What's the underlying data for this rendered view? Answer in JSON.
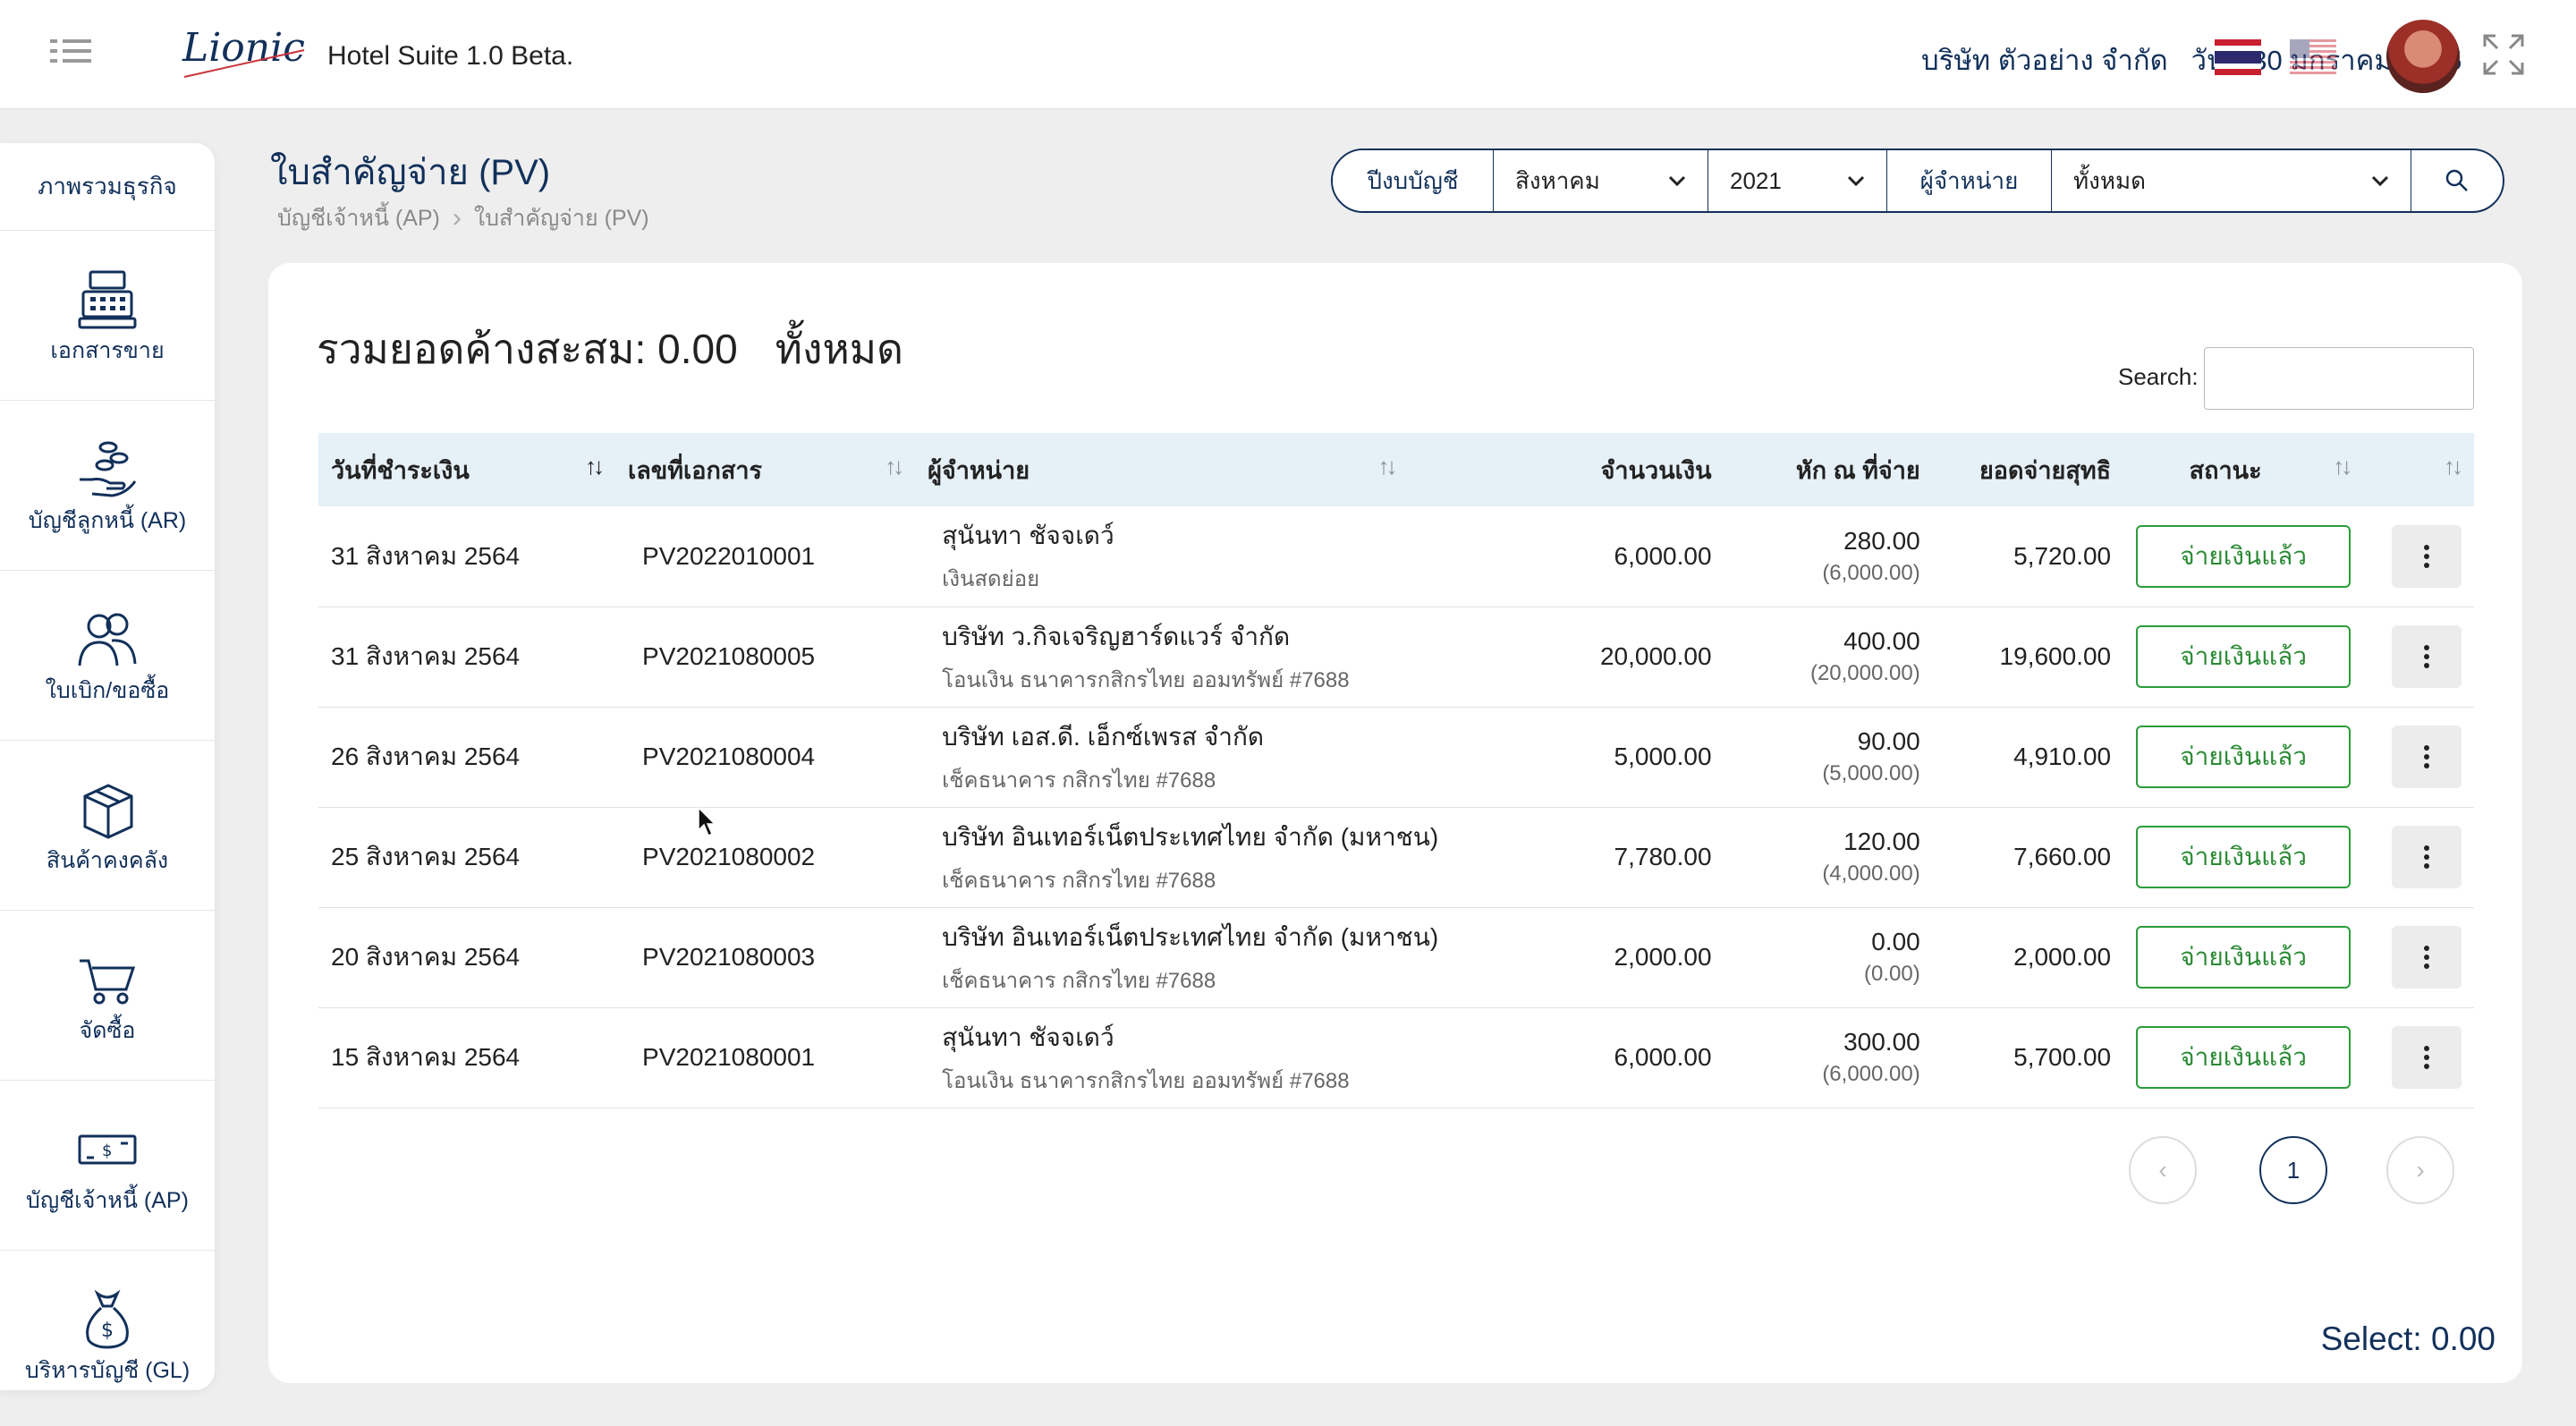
{
  "header": {
    "app_title": "Hotel Suite 1.0 Beta.",
    "logo_text": "Lionic",
    "company": "บริษัท ตัวอย่าง จำกัด",
    "date": "วันที่ 30 มกราคม 2565",
    "icons": [
      "menu-icon",
      "flag-th-icon",
      "flag-us-icon",
      "avatar",
      "expand-icon"
    ]
  },
  "sidebar": {
    "overview": "ภาพรวมธุรกิจ",
    "items": [
      {
        "label": "เอกสารขาย",
        "icon": "cash-register-icon"
      },
      {
        "label": "บัญชีลูกหนี้ (AR)",
        "icon": "hand-coins-icon"
      },
      {
        "label": "ใบเบิก/ขอซื้อ",
        "icon": "people-icon"
      },
      {
        "label": "สินค้าคงคลัง",
        "icon": "box-icon"
      },
      {
        "label": "จัดซื้อ",
        "icon": "cart-icon"
      },
      {
        "label": "บัญชีเจ้าหนี้ (AP)",
        "icon": "banknote-icon"
      },
      {
        "label": "บริหารบัญชี (GL)",
        "icon": "money-bag-icon"
      }
    ]
  },
  "page": {
    "title": "ใบสำคัญจ่าย (PV)",
    "breadcrumb": [
      "บัญชีเจ้าหนี้ (AP)",
      "ใบสำคัญจ่าย (PV)"
    ]
  },
  "filter": {
    "fiscal_label": "ปีงบบัญชี",
    "month": "สิงหาคม",
    "year": "2021",
    "vendor_label": "ผู้จำหน่าย",
    "vendor": "ทั้งหมด"
  },
  "summary": {
    "label": "รวมยอดค้างสะสม: 0.00",
    "scope": "ทั้งหมด"
  },
  "search": {
    "label": "Search:",
    "value": ""
  },
  "table": {
    "headers": [
      "วันที่ชำระเงิน",
      "เลขที่เอกสาร",
      "ผู้จำหน่าย",
      "จำนวนเงิน",
      "หัก ณ ที่จ่าย",
      "ยอดจ่ายสุทธิ",
      "สถานะ",
      ""
    ],
    "rows": [
      {
        "date": "31 สิงหาคม 2564",
        "doc": "PV2022010001",
        "vendor": "สุนันทา ชัจจเดว์",
        "method": "เงินสดย่อย",
        "amount": "6,000.00",
        "wht": "280.00",
        "wht_base": "(6,000.00)",
        "net": "5,720.00",
        "status": "จ่ายเงินแล้ว"
      },
      {
        "date": "31 สิงหาคม 2564",
        "doc": "PV2021080005",
        "vendor": "บริษัท ว.กิจเจริญฮาร์ดแวร์ จำกัด",
        "method": "โอนเงิน ธนาคารกสิกรไทย ออมทรัพย์ #7688",
        "amount": "20,000.00",
        "wht": "400.00",
        "wht_base": "(20,000.00)",
        "net": "19,600.00",
        "status": "จ่ายเงินแล้ว"
      },
      {
        "date": "26 สิงหาคม 2564",
        "doc": "PV2021080004",
        "vendor": "บริษัท เอส.ดี. เอ็กซ์เพรส จำกัด",
        "method": "เช็คธนาคาร กสิกรไทย #7688",
        "amount": "5,000.00",
        "wht": "90.00",
        "wht_base": "(5,000.00)",
        "net": "4,910.00",
        "status": "จ่ายเงินแล้ว"
      },
      {
        "date": "25 สิงหาคม 2564",
        "doc": "PV2021080002",
        "vendor": "บริษัท อินเทอร์เน็ตประเทศไทย จำกัด (มหาชน)",
        "method": "เช็คธนาคาร กสิกรไทย #7688",
        "amount": "7,780.00",
        "wht": "120.00",
        "wht_base": "(4,000.00)",
        "net": "7,660.00",
        "status": "จ่ายเงินแล้ว"
      },
      {
        "date": "20 สิงหาคม 2564",
        "doc": "PV2021080003",
        "vendor": "บริษัท อินเทอร์เน็ตประเทศไทย จำกัด (มหาชน)",
        "method": "เช็คธนาคาร กสิกรไทย #7688",
        "amount": "2,000.00",
        "wht": "0.00",
        "wht_base": "(0.00)",
        "net": "2,000.00",
        "status": "จ่ายเงินแล้ว"
      },
      {
        "date": "15 สิงหาคม 2564",
        "doc": "PV2021080001",
        "vendor": "สุนันทา ชัจจเดว์",
        "method": "โอนเงิน ธนาคารกสิกรไทย ออมทรัพย์ #7688",
        "amount": "6,000.00",
        "wht": "300.00",
        "wht_base": "(6,000.00)",
        "net": "5,700.00",
        "status": "จ่ายเงินแล้ว"
      }
    ]
  },
  "pagination": {
    "current": "1"
  },
  "footer": {
    "select_total": "Select: 0.00"
  },
  "colors": {
    "primary": "#12305a",
    "paid_green": "#2a9d3a",
    "table_header": "#e6f0f7"
  }
}
